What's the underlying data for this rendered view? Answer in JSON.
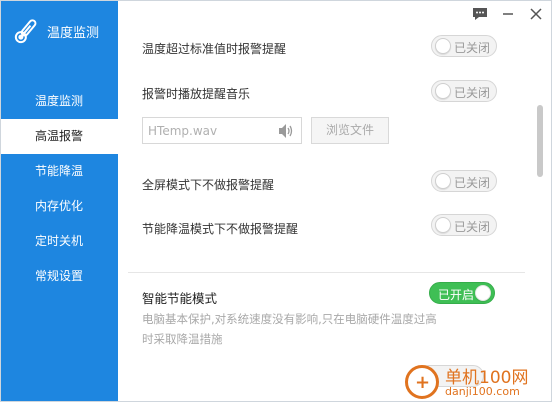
{
  "app": {
    "title": "温度监测"
  },
  "sidebar": {
    "items": [
      {
        "label": "温度监测",
        "active": false
      },
      {
        "label": "高温报警",
        "active": true
      },
      {
        "label": "节能降温",
        "active": false
      },
      {
        "label": "内存优化",
        "active": false
      },
      {
        "label": "定时关机",
        "active": false
      },
      {
        "label": "常规设置",
        "active": false
      }
    ]
  },
  "topbar": {
    "icons": [
      "chat-icon",
      "minimize-icon",
      "close-icon"
    ]
  },
  "settings": {
    "over_threshold": {
      "label": "温度超过标准值时报警提醒",
      "toggle": "已关闭",
      "on": false
    },
    "play_music": {
      "label": "报警时播放提醒音乐",
      "toggle": "已关闭",
      "on": false
    },
    "sound_file": {
      "value": "HTemp.wav",
      "browse_label": "浏览文件"
    },
    "fullscreen": {
      "label": "全屏模式下不做报警提醒",
      "toggle": "已关闭",
      "on": false
    },
    "power_save": {
      "label": "节能降温模式下不做报警提醒",
      "toggle": "已关闭",
      "on": false
    },
    "smart_mode": {
      "label": "智能节能模式",
      "toggle": "已开启",
      "on": true,
      "description": "电脑基本保护,对系统速度没有影响,只在电脑硬件温度过高时采取降温措施"
    }
  },
  "watermark": {
    "text": "单机100网",
    "sub": "danji100.com"
  },
  "colors": {
    "sidebar_bg": "#1e86e0",
    "toggle_on": "#3fbf55",
    "toggle_off": "#f3f3f3",
    "watermark": "#e0731f"
  }
}
